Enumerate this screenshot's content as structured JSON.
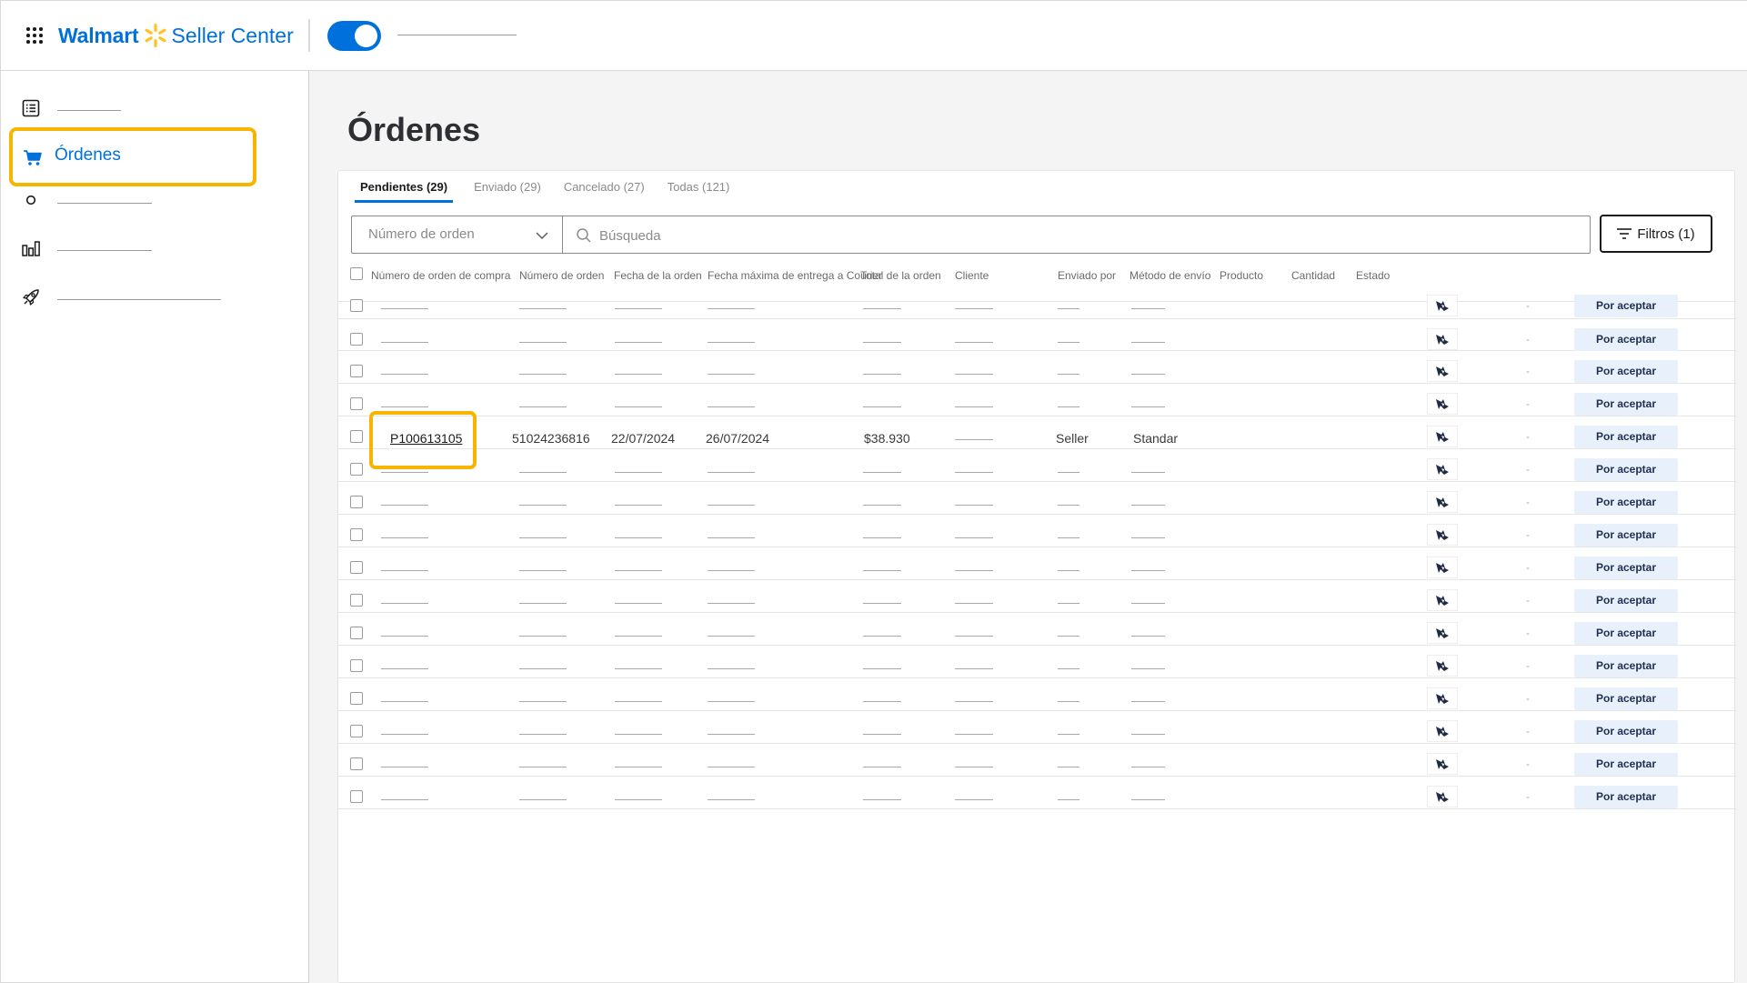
{
  "header": {
    "brand_walmart": "Walmart",
    "brand_seller": "Seller Center",
    "toggle_on": true
  },
  "sidebar": {
    "active_label": "Órdenes",
    "items": [
      {
        "icon": "list-icon"
      },
      {
        "icon": "cart-icon",
        "label": "Órdenes"
      },
      {
        "icon": "circle-icon"
      },
      {
        "icon": "bar-chart-icon"
      },
      {
        "icon": "rocket-icon"
      }
    ]
  },
  "page": {
    "title": "Órdenes"
  },
  "tabs": [
    {
      "label": "Pendientes (29)",
      "active": true
    },
    {
      "label": "Enviado (29)"
    },
    {
      "label": "Cancelado (27)"
    },
    {
      "label": "Todas (121)"
    }
  ],
  "filters": {
    "select_placeholder": "Número de orden",
    "search_placeholder": "Búsqueda",
    "filters_label": "Filtros (1)"
  },
  "table": {
    "columns": [
      "Número de orden de compra",
      "Número de orden",
      "Fecha de la orden",
      "Fecha máxima de entrega a Courier",
      "Total de la orden",
      "Cliente",
      "Enviado por",
      "Método de envío",
      "Producto",
      "Cantidad",
      "Estado"
    ],
    "highlighted_row": {
      "po_number": "P100613105",
      "order_number": "51024236816",
      "order_date": "22/07/2024",
      "max_delivery": "26/07/2024",
      "total": "$38.930",
      "shipped_by": "Seller",
      "method": "Standar"
    },
    "quantity_placeholder": "-",
    "status_label": "Por aceptar",
    "row_count": 16,
    "highlighted_index": 4
  },
  "colors": {
    "brand_blue": "#0071dc",
    "spark_yellow": "#ffc220",
    "highlight_outline": "#f7b500",
    "status_bg": "#e8f1fb"
  }
}
